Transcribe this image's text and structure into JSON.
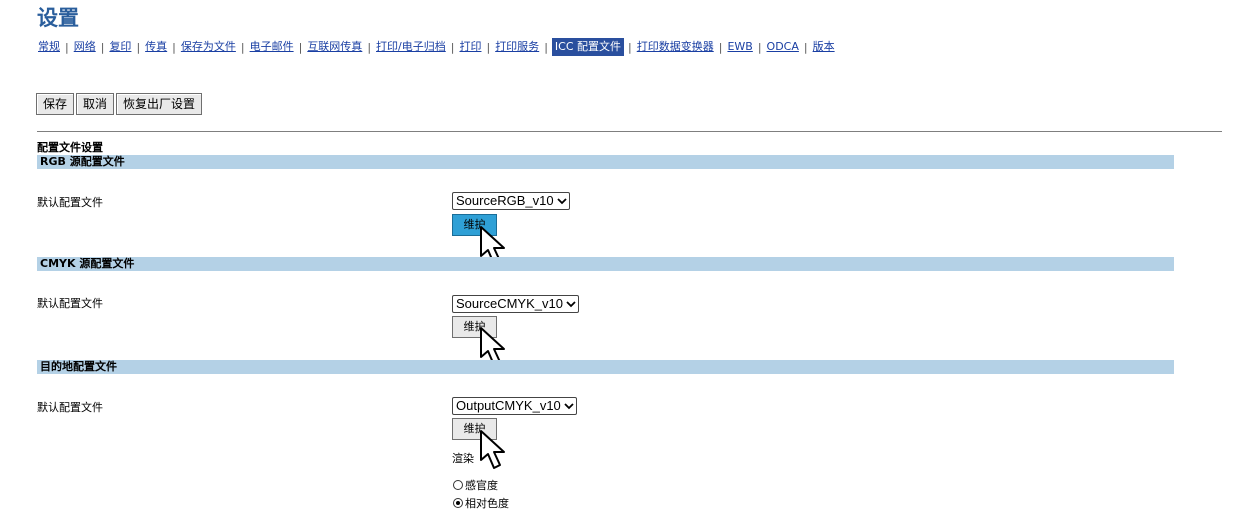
{
  "header": {
    "title": "设置"
  },
  "tabs": [
    {
      "label": "常规",
      "active": false
    },
    {
      "label": "网络",
      "active": false
    },
    {
      "label": "复印",
      "active": false
    },
    {
      "label": "传真",
      "active": false
    },
    {
      "label": "保存为文件",
      "active": false
    },
    {
      "label": "电子邮件",
      "active": false
    },
    {
      "label": "互联网传真",
      "active": false
    },
    {
      "label": "打印/电子归档",
      "active": false
    },
    {
      "label": "打印",
      "active": false
    },
    {
      "label": "打印服务",
      "active": false
    },
    {
      "label": "ICC 配置文件",
      "active": true
    },
    {
      "label": "打印数据变换器",
      "active": false
    },
    {
      "label": "EWB",
      "active": false
    },
    {
      "label": "ODCA",
      "active": false
    },
    {
      "label": "版本",
      "active": false
    }
  ],
  "toolbar": {
    "save_label": "保存",
    "cancel_label": "取消",
    "reset_label": "恢复出厂设置"
  },
  "page_heading": "配置文件设置",
  "sections": [
    {
      "title": "RGB 源配置文件",
      "label": "默认配置文件",
      "selected": "SourceRGB_v10",
      "button": "维护"
    },
    {
      "title": "CMYK 源配置文件",
      "label": "默认配置文件",
      "selected": "SourceCMYK_v10",
      "button": "维护"
    },
    {
      "title": "目的地配置文件",
      "label": "默认配置文件",
      "selected": "OutputCMYK_v10",
      "button": "维护"
    }
  ],
  "rendering": {
    "label": "渲染",
    "options": [
      {
        "label": "感官度",
        "checked": false
      },
      {
        "label": "相对色度",
        "checked": true
      }
    ]
  },
  "colors": {
    "accent_tab": "#2a4f9e",
    "section_bar": "#b4d1e6",
    "title": "#2a5e9c",
    "hover_button": "#2fa0d6"
  }
}
